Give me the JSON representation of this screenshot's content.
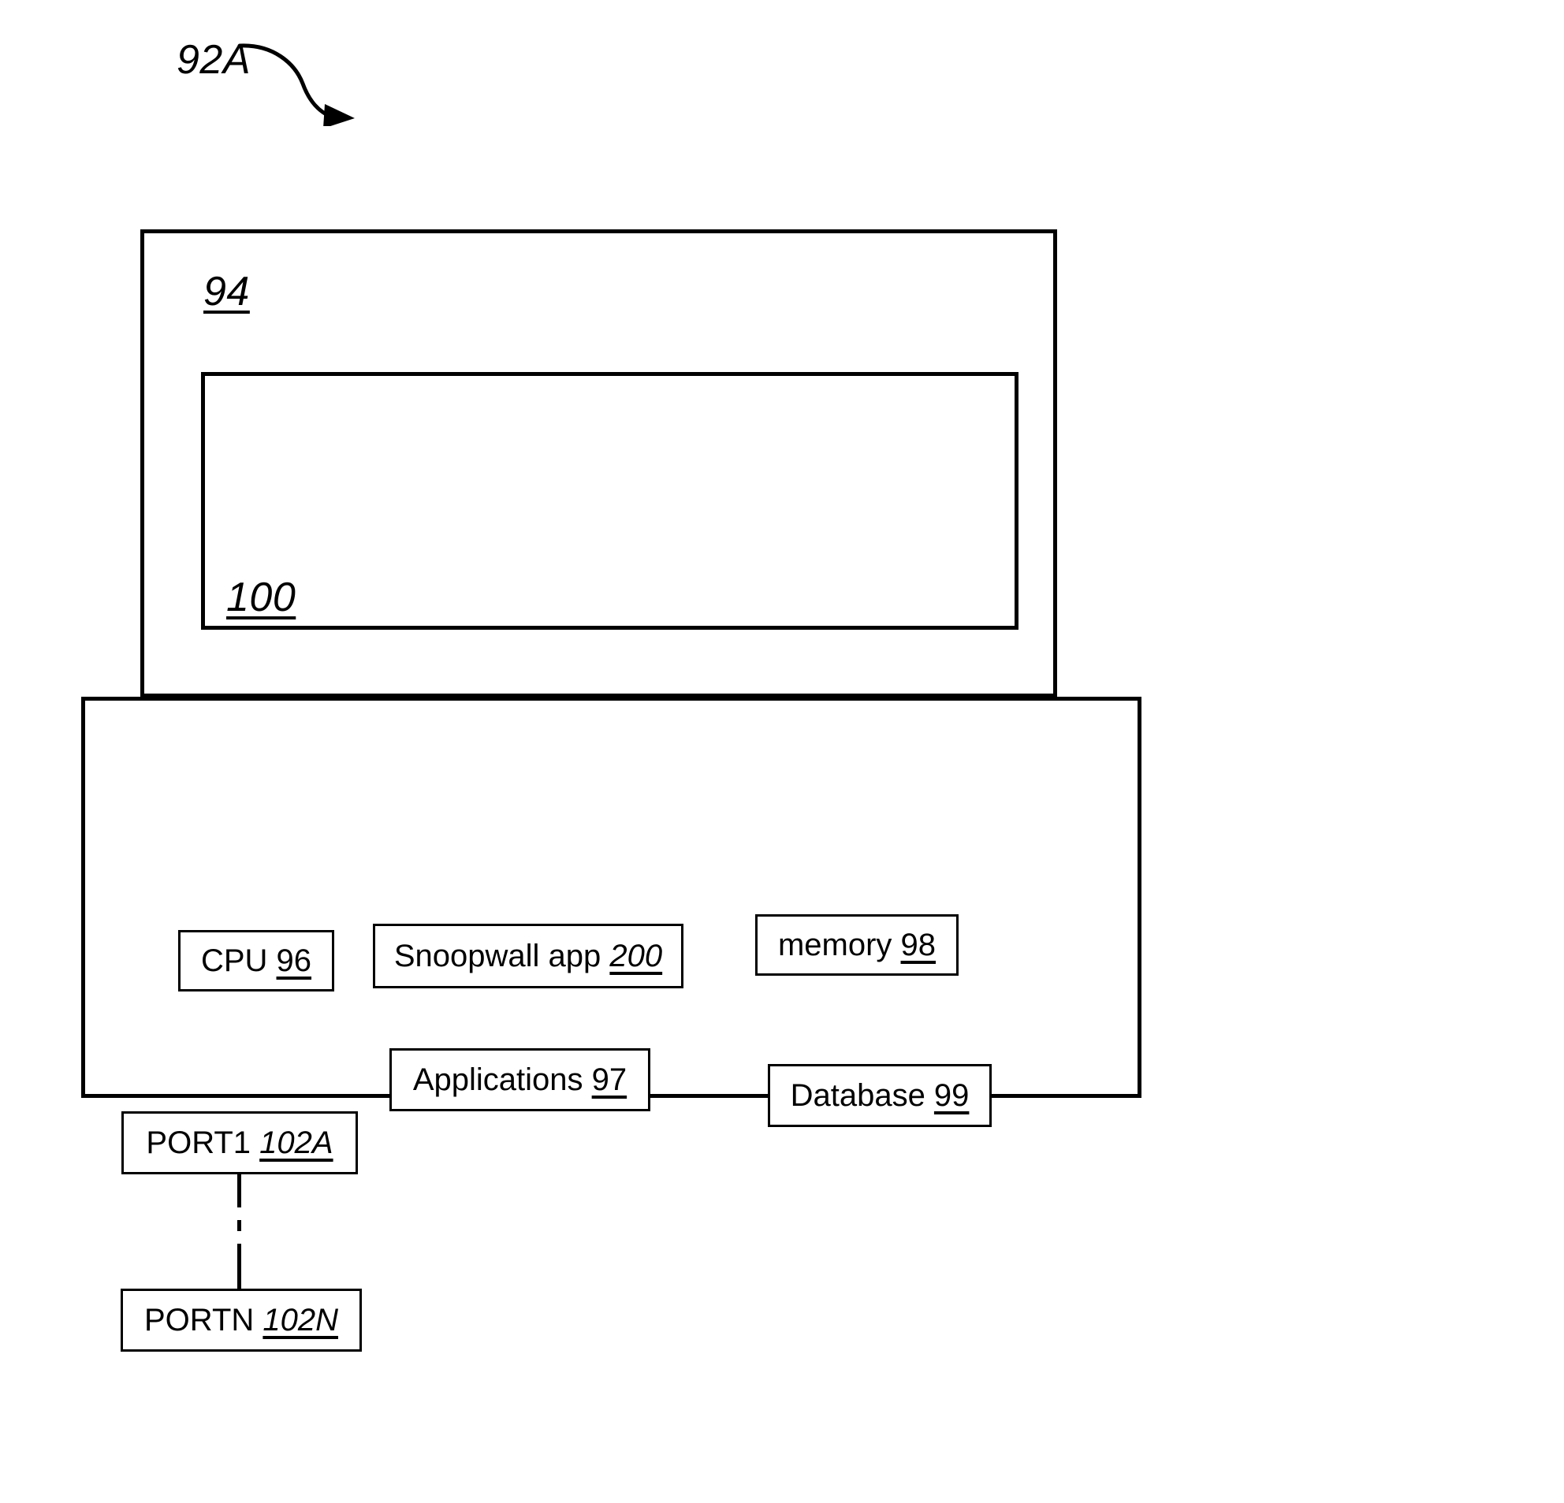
{
  "figure": {
    "title_label": "92A",
    "enclosures": {
      "lid_label": "94",
      "screen_label": "100"
    },
    "lead_arrow_icon": "curved-arrow-icon"
  },
  "components": [
    {
      "id": "cpu",
      "text": "CPU ",
      "number": "96",
      "number_style": "upright"
    },
    {
      "id": "snoopwall",
      "text": "Snoopwall app ",
      "number": "200",
      "number_style": "italic"
    },
    {
      "id": "memory",
      "text": "memory ",
      "number": "98",
      "number_style": "upright"
    },
    {
      "id": "apps",
      "text": "Applications ",
      "number": "97",
      "number_style": "upright"
    },
    {
      "id": "database",
      "text": "Database ",
      "number": "99",
      "number_style": "upright"
    },
    {
      "id": "port1",
      "text": "PORT1 ",
      "number": "102A",
      "number_style": "italic"
    },
    {
      "id": "portn",
      "text": "PORTN ",
      "number": "102N",
      "number_style": "italic"
    }
  ],
  "connector": {
    "name": "port-dash-dot-connector",
    "style": "dash-dot-vertical"
  },
  "colors": {
    "stroke": "#000000",
    "background": "#ffffff"
  }
}
